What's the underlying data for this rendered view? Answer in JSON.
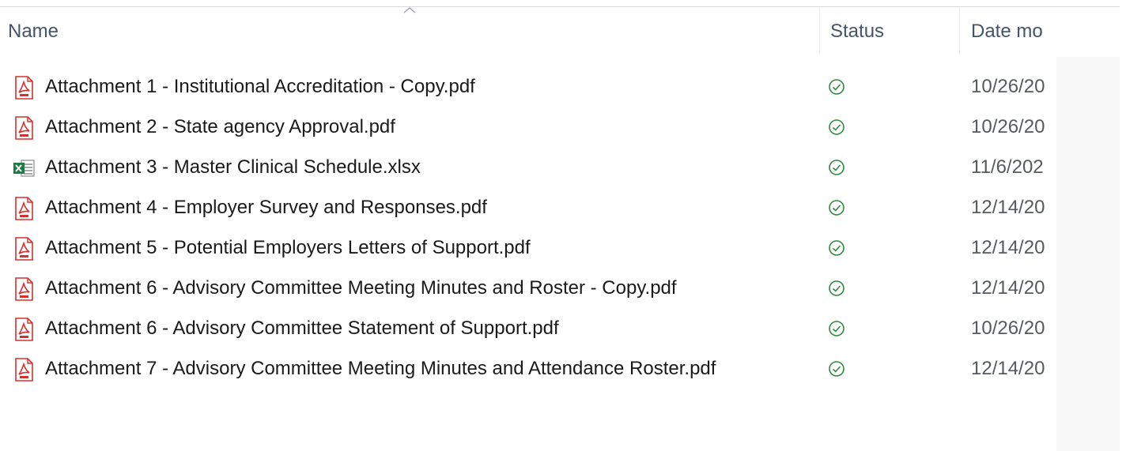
{
  "columns": {
    "name": "Name",
    "status": "Status",
    "date": "Date mo"
  },
  "colors": {
    "pdf_red": "#d6312c",
    "excel_green": "#1d7a44",
    "status_green": "#2f8a3f"
  },
  "files": [
    {
      "name": "Attachment 1 - Institutional Accreditation - Copy.pdf",
      "type": "pdf-icon",
      "status": "synced-icon",
      "date": "10/26/20"
    },
    {
      "name": "Attachment 2 - State agency Approval.pdf",
      "type": "pdf-icon",
      "status": "synced-icon",
      "date": "10/26/20"
    },
    {
      "name": "Attachment 3 - Master Clinical Schedule.xlsx",
      "type": "excel-icon",
      "status": "synced-icon",
      "date": "11/6/202"
    },
    {
      "name": "Attachment 4 - Employer Survey and Responses.pdf",
      "type": "pdf-icon",
      "status": "synced-icon",
      "date": "12/14/20"
    },
    {
      "name": "Attachment 5 - Potential Employers Letters of Support.pdf",
      "type": "pdf-icon",
      "status": "synced-icon",
      "date": "12/14/20"
    },
    {
      "name": "Attachment 6 - Advisory Committee Meeting Minutes and Roster - Copy.pdf",
      "type": "pdf-icon",
      "status": "synced-icon",
      "date": "12/14/20"
    },
    {
      "name": "Attachment 6 - Advisory Committee Statement of Support.pdf",
      "type": "pdf-icon",
      "status": "synced-icon",
      "date": "10/26/20"
    },
    {
      "name": "Attachment 7 - Advisory Committee Meeting Minutes and Attendance Roster.pdf",
      "type": "pdf-icon",
      "status": "synced-icon",
      "date": "12/14/20"
    }
  ]
}
